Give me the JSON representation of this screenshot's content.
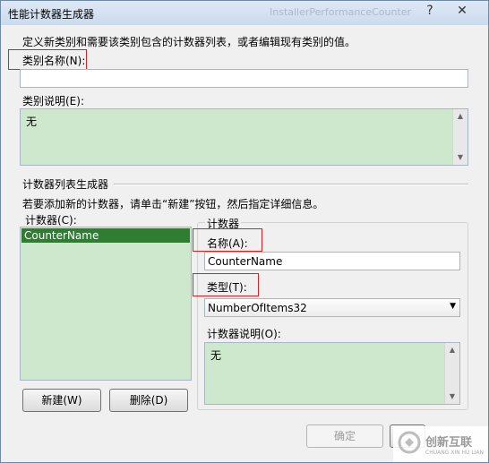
{
  "window": {
    "title": "性能计数器生成器",
    "ghost_title": "InstallerPerformanceCounter",
    "help_glyph": "?",
    "close_glyph": "✕"
  },
  "intro": "定义新类别和需要该类别包含的计数器列表，或者编辑现有类别的值。",
  "category": {
    "name_label": "类别名称(N):",
    "name_value": "",
    "desc_label": "类别说明(E):",
    "desc_value": "无"
  },
  "builder": {
    "heading": "计数器列表生成器",
    "hint": "若要添加新的计数器，请单击“新建”按钮，然后指定详细信息。",
    "counters_label": "计数器(C):",
    "counters": [
      "CounterName"
    ],
    "new_button": "新建(W)",
    "delete_button": "删除(D)"
  },
  "counter": {
    "group_label": "计数器",
    "name_label": "名称(A):",
    "name_value": "CounterName",
    "type_label": "类型(T):",
    "type_value": "NumberOfItems32",
    "desc_label": "计数器说明(O):",
    "desc_value": "无"
  },
  "footer": {
    "ok_button": "确定"
  },
  "watermark": {
    "brand": "创新互联",
    "sub": "CHUANG XIN HU LIAN"
  },
  "colors": {
    "highlight": "#2e7d32",
    "readonly_green": "#cde8cd",
    "annotation_red": "#e02020"
  }
}
